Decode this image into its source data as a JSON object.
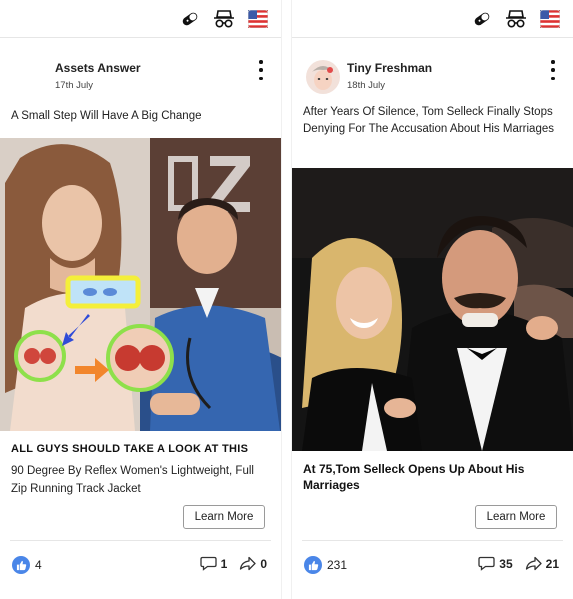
{
  "colors": {
    "accent": "#4a86e8",
    "divider": "#e6e6e6"
  },
  "top_icons": [
    "pill-icon",
    "incognito-icon",
    "us-flag-icon"
  ],
  "cards": [
    {
      "author": "Assets Answer",
      "date": "17th July",
      "title": "A Small Step Will Have A Big Change",
      "headline": "ALL GUYS SHOULD TAKE A LOOK AT THIS",
      "description": "90 Degree By Reflex Women's Lightweight, Full Zip Running Track Jacket",
      "cta": "Learn More",
      "likes": "4",
      "comments": "1",
      "shares": "0"
    },
    {
      "author": "Tiny Freshman",
      "date": "18th July",
      "title": "After Years Of Silence, Tom Selleck Finally Stops Denying For The Accusation About His Marriages",
      "headline": "At 75,Tom Selleck Opens Up About His Marriages",
      "cta": "Learn More",
      "likes": "231",
      "comments": "35",
      "shares": "21"
    }
  ]
}
